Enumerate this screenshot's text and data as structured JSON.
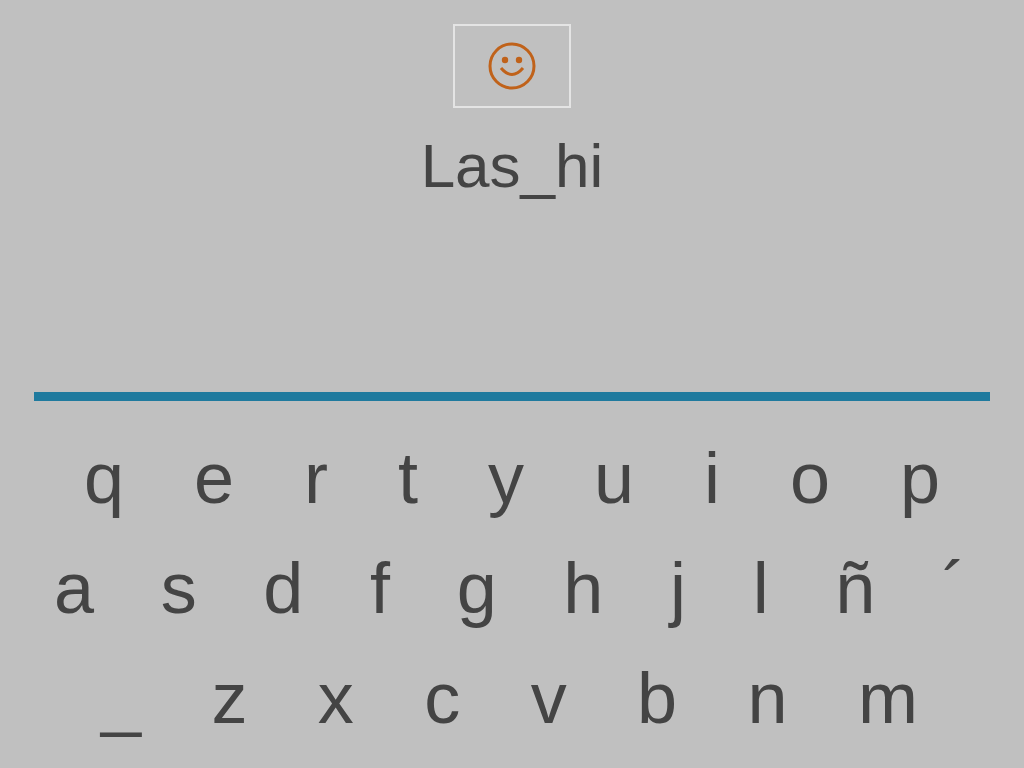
{
  "word": "Las_hi",
  "keyboard": [
    [
      "q",
      "e",
      "r",
      "t",
      "y",
      "u",
      "i",
      "o",
      "p"
    ],
    [
      "a",
      "s",
      "d",
      "f",
      "g",
      "h",
      "j",
      "l",
      "ñ",
      "´"
    ],
    [
      "_",
      "z",
      "x",
      "c",
      "v",
      "b",
      "n",
      "m"
    ]
  ]
}
